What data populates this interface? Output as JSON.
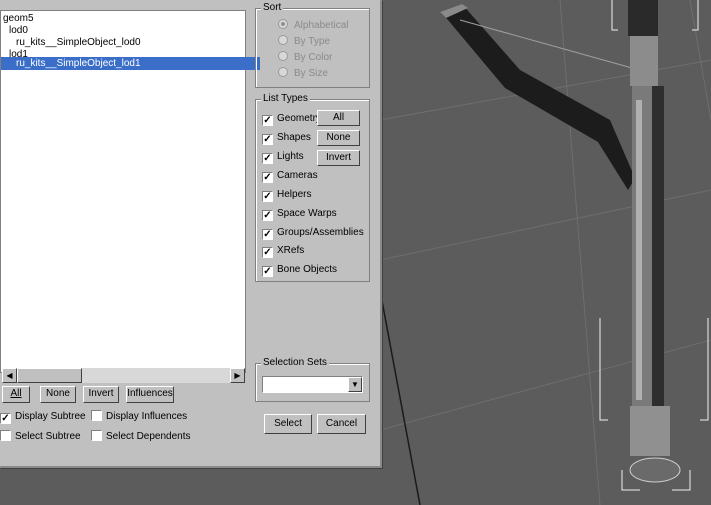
{
  "tree": {
    "nodes": [
      {
        "label": "geom5",
        "indent": 0,
        "selected": false
      },
      {
        "label": "lod0",
        "indent": 1,
        "selected": false
      },
      {
        "label": "ru_kits__SimpleObject_lod0",
        "indent": 2,
        "selected": false
      },
      {
        "label": "lod1",
        "indent": 1,
        "selected": false
      },
      {
        "label": "ru_kits__SimpleObject_lod1",
        "indent": 2,
        "selected": true
      }
    ]
  },
  "bottom_buttons": {
    "all": "All",
    "none": "None",
    "invert": "Invert",
    "influences": "Influences"
  },
  "options": {
    "display_subtree": {
      "label": "Display Subtree",
      "checked": true
    },
    "display_influences": {
      "label": "Display Influences",
      "checked": false
    },
    "select_subtree": {
      "label": "Select Subtree",
      "checked": false
    },
    "select_dependents": {
      "label": "Select Dependents",
      "checked": false
    }
  },
  "sort": {
    "title": "Sort",
    "options": [
      {
        "label": "Alphabetical",
        "selected": true
      },
      {
        "label": "By Type",
        "selected": false
      },
      {
        "label": "By Color",
        "selected": false
      },
      {
        "label": "By Size",
        "selected": false
      }
    ]
  },
  "list_types": {
    "title": "List Types",
    "items": [
      {
        "label": "Geometry",
        "checked": true
      },
      {
        "label": "Shapes",
        "checked": true
      },
      {
        "label": "Lights",
        "checked": true
      },
      {
        "label": "Cameras",
        "checked": true
      },
      {
        "label": "Helpers",
        "checked": true
      },
      {
        "label": "Space Warps",
        "checked": true
      },
      {
        "label": "Groups/Assemblies",
        "checked": true
      },
      {
        "label": "XRefs",
        "checked": true
      },
      {
        "label": "Bone Objects",
        "checked": true
      }
    ],
    "buttons": {
      "all": "All",
      "none": "None",
      "invert": "Invert"
    }
  },
  "selection_sets": {
    "title": "Selection Sets",
    "value": ""
  },
  "actions": {
    "select": "Select",
    "cancel": "Cancel"
  },
  "icons": {
    "checkmark": "✓",
    "combo_arrow": "▼",
    "scroll_left": "◀",
    "scroll_right": "▶"
  }
}
